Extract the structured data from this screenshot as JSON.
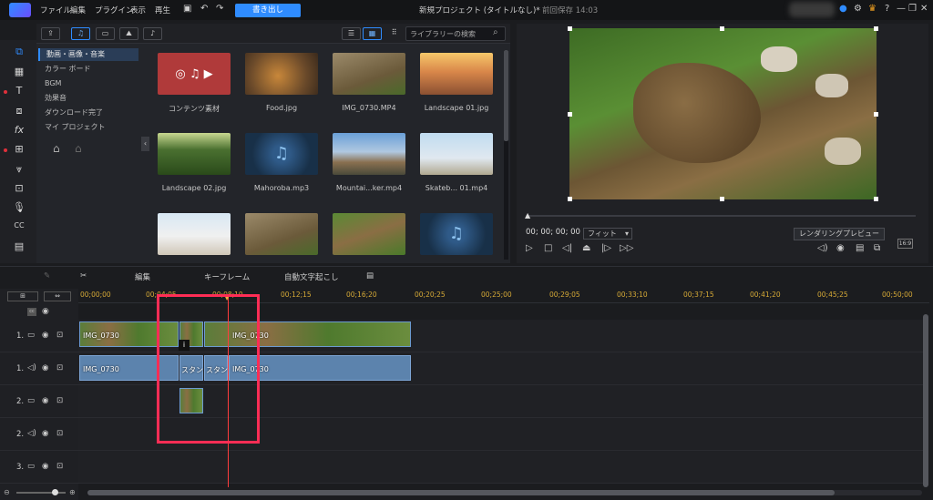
{
  "titlebar": {
    "menus": [
      "ファイル",
      "編集",
      "プラグイン",
      "表示",
      "再生"
    ],
    "write_button": "書き出し",
    "project_title": "新規プロジェクト (タイトルなし)*",
    "save_status": "前回保存 14:03"
  },
  "library": {
    "search_placeholder": "ライブラリーの検索",
    "categories": [
      "動画・画像・音楽",
      "カラー ボード",
      "BGM",
      "効果音",
      "ダウンロード完了",
      "マイ プロジェクト"
    ],
    "media": [
      {
        "name": "コンテンツ素材",
        "kind": "content"
      },
      {
        "name": "Food.jpg",
        "kind": "food"
      },
      {
        "name": "IMG_0730.MP4",
        "kind": "dirt"
      },
      {
        "name": "Landscape 01.jpg",
        "kind": "canyon"
      },
      {
        "name": "Landscape 02.jpg",
        "kind": "forest"
      },
      {
        "name": "Mahoroba.mp3",
        "kind": "music"
      },
      {
        "name": "Mountai...ker.mp4",
        "kind": "mountain"
      },
      {
        "name": "Skateb... 01.mp4",
        "kind": "skate"
      },
      {
        "name": "",
        "kind": "skate2"
      },
      {
        "name": "",
        "kind": "dirt"
      },
      {
        "name": "",
        "kind": "rock"
      },
      {
        "name": "",
        "kind": "music"
      }
    ]
  },
  "preview": {
    "timecode": "00; 00; 00; 00",
    "fit_label": "フィット",
    "render_button": "レンダリングプレビュー",
    "aspect": "16:9"
  },
  "edit_toolbar": {
    "edit_label": "編集",
    "keyframe_label": "キーフレーム",
    "caption_label": "自動文字起こし"
  },
  "timeline": {
    "ruler_ticks": [
      "00;00;00",
      "00;04;05",
      "00;08;10",
      "00;12;15",
      "00;16;20",
      "00;20;25",
      "00;25;00",
      "00;29;05",
      "00;33;10",
      "00;37;15",
      "00;41;20",
      "00;45;25",
      "00;50;00"
    ],
    "tracks": [
      {
        "label": "1.",
        "kind": "video"
      },
      {
        "label": "1.",
        "kind": "audio"
      },
      {
        "label": "2.",
        "kind": "video"
      },
      {
        "label": "2.",
        "kind": "audio"
      },
      {
        "label": "3.",
        "kind": "video"
      }
    ],
    "video_clip_1": "IMG_0730",
    "video_clip_2": "IMG_0730",
    "audio_clip_1": "IMG_0730",
    "audio_clip_2": "IMG_0730",
    "standby_1": "スタンド",
    "standby_2": "スタンド",
    "info_badge": "i"
  },
  "colors": {
    "accent": "#2f8cff",
    "highlight": "#ff2d55",
    "playhead": "#ff3d3d",
    "ruler": "#d4a836"
  }
}
